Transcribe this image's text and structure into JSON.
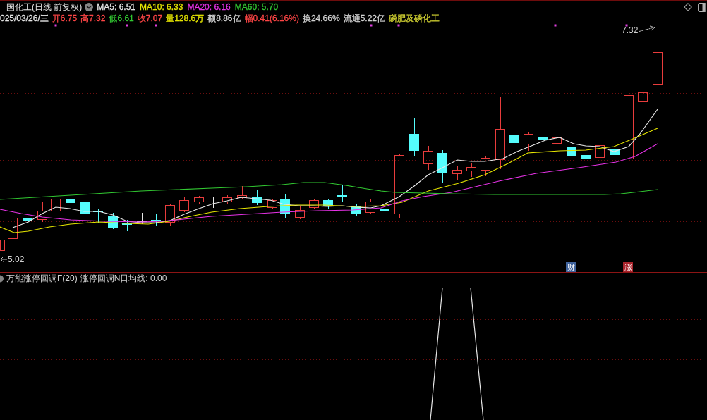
{
  "header": {
    "title": "国化工(日线 前复权)",
    "moving_averages": [
      {
        "label": "MA5: 6.51",
        "color": "#e6e6e6"
      },
      {
        "label": "MA10: 6.33",
        "color": "#e6e600"
      },
      {
        "label": "MA20: 6.16",
        "color": "#e632e6"
      },
      {
        "label": "MA60: 5.70",
        "color": "#32c832"
      }
    ],
    "quote": [
      {
        "label": "025/03/26/三",
        "color": "#e6e6e6"
      },
      {
        "label": "开6.75",
        "color": "#ff4646"
      },
      {
        "label": "高7.32",
        "color": "#ff4646"
      },
      {
        "label": "低6.61",
        "color": "#32c832"
      },
      {
        "label": "收7.07",
        "color": "#ff4646"
      },
      {
        "label": "量128.6万",
        "color": "#e6e600"
      },
      {
        "label": "额8.86亿",
        "color": "#d2d2d2"
      },
      {
        "label": "幅0.41(6.16%)",
        "color": "#ff4646"
      },
      {
        "label": "换24.66%",
        "color": "#d2d2d2"
      },
      {
        "label": "流通5.22亿",
        "color": "#d2d2d2"
      },
      {
        "label": "磷肥及磷化工",
        "color": "#d2d232"
      }
    ]
  },
  "chart": {
    "high_label": "7.32",
    "low_label": "5.02",
    "badges": [
      {
        "text": "财",
        "color": "#40639c"
      },
      {
        "text": "涨",
        "color": "#a8232b"
      }
    ]
  },
  "indicator": {
    "name": "万能涨停回调F(20)",
    "readings": [
      "涨停回调N日均线: 0.00"
    ]
  }
}
